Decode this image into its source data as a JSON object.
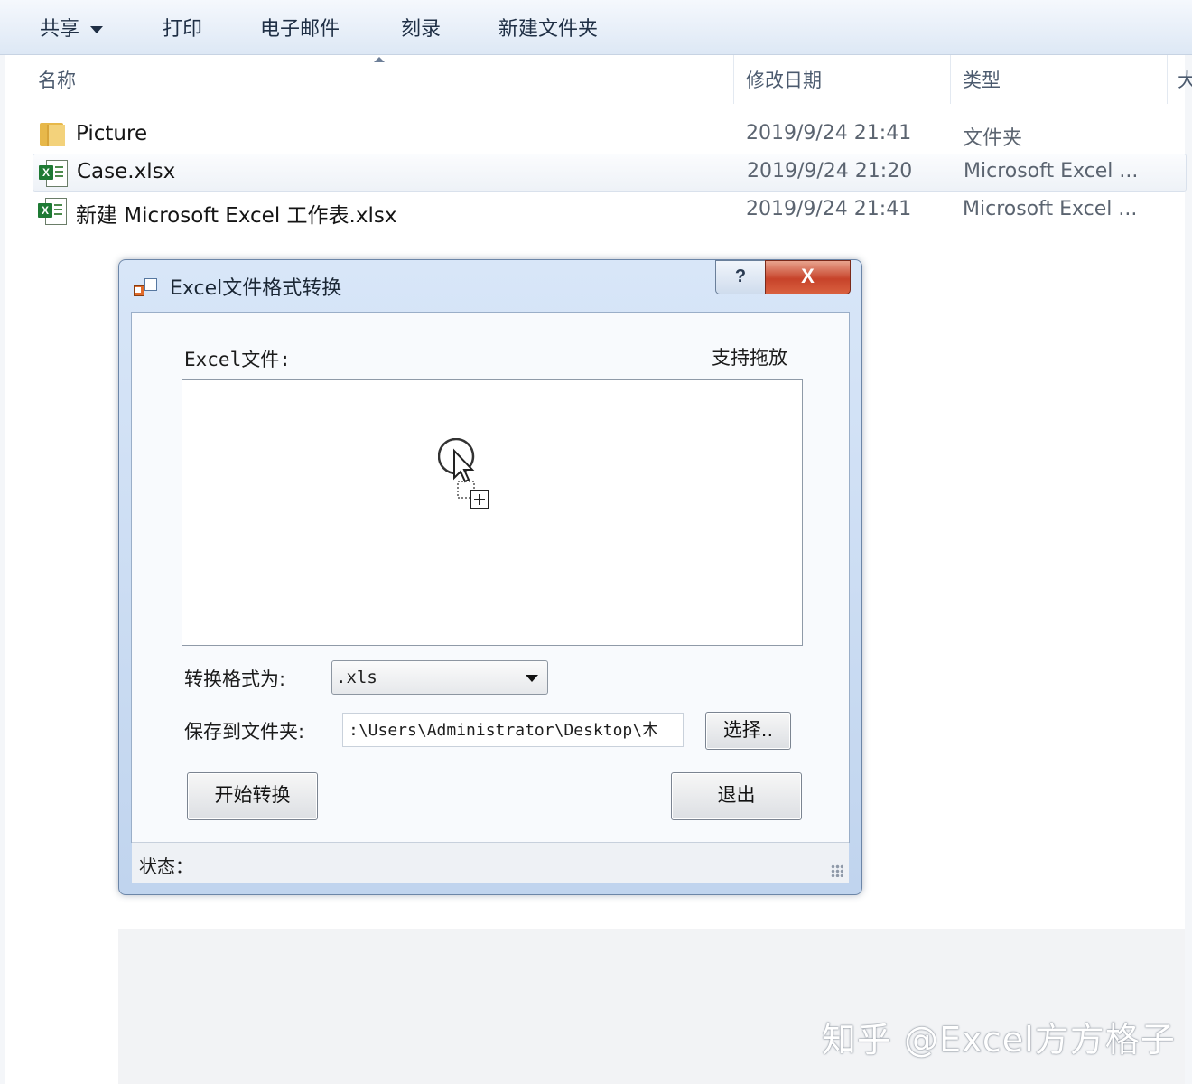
{
  "toolbar": {
    "share": "共享",
    "print": "打印",
    "email": "电子邮件",
    "burn": "刻录",
    "new_folder": "新建文件夹"
  },
  "columns": {
    "name": "名称",
    "date": "修改日期",
    "type": "类型",
    "size": "大"
  },
  "files": [
    {
      "name": "Picture",
      "date": "2019/9/24 21:41",
      "type": "文件夹",
      "icon": "folder-icon"
    },
    {
      "name": "Case.xlsx",
      "date": "2019/9/24 21:20",
      "type": "Microsoft Excel ...",
      "icon": "excel-file-icon",
      "selected": true
    },
    {
      "name": "新建 Microsoft Excel 工作表.xlsx",
      "date": "2019/9/24 21:41",
      "type": "Microsoft Excel ...",
      "icon": "excel-file-icon"
    }
  ],
  "dialog": {
    "title": "Excel文件格式转换",
    "help": "?",
    "close": "X",
    "excel_file_label": "Excel文件:",
    "drag_hint": "支持拖放",
    "format_label": "转换格式为:",
    "format_value": ".xls",
    "save_label": "保存到文件夹:",
    "save_path": ":\\Users\\Administrator\\Desktop\\木",
    "choose_button": "选择..",
    "start_button": "开始转换",
    "exit_button": "退出",
    "status_label": "状态："
  },
  "watermark": "知乎 @Excel方方格子"
}
